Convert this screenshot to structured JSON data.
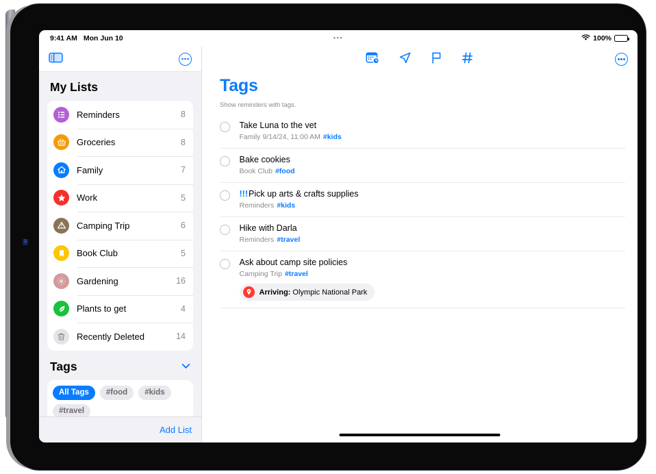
{
  "status_bar": {
    "time": "9:41 AM",
    "date": "Mon Jun 10",
    "multitask_icon": "more-dots-icon",
    "wifi_icon": "wifi-icon",
    "battery_percent": "100%",
    "battery_icon": "battery-full-icon"
  },
  "sidebar": {
    "toggle_icon": "sidebar-toggle-icon",
    "more_icon": "more-circle-icon",
    "my_lists_title": "My Lists",
    "lists": [
      {
        "label": "Reminders",
        "count": "8",
        "color": "#b35fd6",
        "icon": "list-bullet-icon"
      },
      {
        "label": "Groceries",
        "count": "8",
        "color": "#f59a0b",
        "icon": "basket-icon"
      },
      {
        "label": "Family",
        "count": "7",
        "color": "#0a7cff",
        "icon": "house-icon"
      },
      {
        "label": "Work",
        "count": "5",
        "color": "#f4302c",
        "icon": "star-icon"
      },
      {
        "label": "Camping Trip",
        "count": "6",
        "color": "#8a7358",
        "icon": "tent-icon"
      },
      {
        "label": "Book Club",
        "count": "5",
        "color": "#fcc60a",
        "icon": "bookmark-icon"
      },
      {
        "label": "Gardening",
        "count": "16",
        "color": "#d29a9a",
        "icon": "sun-icon"
      },
      {
        "label": "Plants to get",
        "count": "4",
        "color": "#19c13d",
        "icon": "leaf-icon"
      },
      {
        "label": "Recently Deleted",
        "count": "14",
        "color": "#e3e3e8",
        "icon": "trash-icon"
      }
    ],
    "tags_title": "Tags",
    "tags_collapse_icon": "chevron-down-icon",
    "tag_chips": [
      {
        "label": "All Tags",
        "selected": true
      },
      {
        "label": "#food",
        "selected": false
      },
      {
        "label": "#kids",
        "selected": false
      },
      {
        "label": "#travel",
        "selected": false
      }
    ],
    "add_list_label": "Add List"
  },
  "main": {
    "toolbar_icons": [
      "scheduled-calendar-icon",
      "location-arrow-icon",
      "flag-icon",
      "hashtag-icon"
    ],
    "more_icon": "more-circle-icon",
    "title": "Tags",
    "subtitle": "Show reminders with tags.",
    "reminders": [
      {
        "priority": "",
        "title": "Take Luna to the vet",
        "list": "Family",
        "date": "9/14/24, 11:00 AM",
        "tag": "#kids"
      },
      {
        "priority": "",
        "title": "Bake cookies",
        "list": "Book Club",
        "date": "",
        "tag": "#food"
      },
      {
        "priority": "!!!",
        "title": "Pick up arts & crafts supplies",
        "list": "Reminders",
        "date": "",
        "tag": "#kids"
      },
      {
        "priority": "",
        "title": "Hike with Darla",
        "list": "Reminders",
        "date": "",
        "tag": "#travel"
      },
      {
        "priority": "",
        "title": "Ask about camp site policies",
        "list": "Camping Trip",
        "date": "",
        "tag": "#travel",
        "location": {
          "icon": "location-pin-icon",
          "label": "Arriving:",
          "place": "Olympic National Park"
        }
      }
    ]
  },
  "colors": {
    "accent": "#0a7cff",
    "sidebar_bg": "#f1f1f6",
    "muted_text": "#8a8a8e",
    "alert_red": "#ff3b30"
  }
}
